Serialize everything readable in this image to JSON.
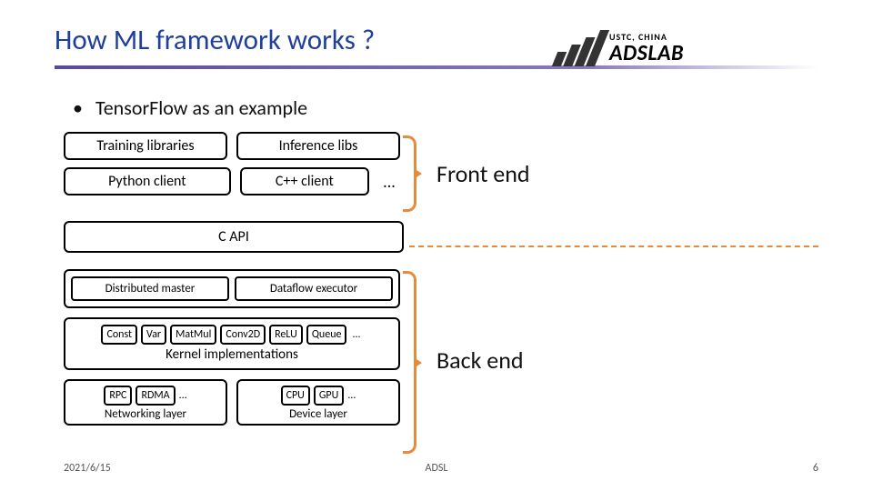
{
  "header": {
    "title": "How ML framework works ?",
    "logo_sub": "USTC, CHINA",
    "logo_main": "ADSLAB"
  },
  "bullet": "TensorFlow as an example",
  "diagram": {
    "front": {
      "row1": {
        "a": "Training libraries",
        "b": "Inference libs"
      },
      "row2": {
        "a": "Python client",
        "b": "C++ client",
        "ellipsis": "..."
      }
    },
    "capi": "C API",
    "back": {
      "topgroup": {
        "a": "Distributed master",
        "b": "Dataflow executor"
      },
      "kernel": {
        "chips": [
          "Const",
          "Var",
          "MatMul",
          "Conv2D",
          "ReLU",
          "Queue",
          "..."
        ],
        "title": "Kernel implementations"
      },
      "net": {
        "chips": [
          "RPC",
          "RDMA",
          "..."
        ],
        "title": "Networking layer"
      },
      "dev": {
        "chips": [
          "CPU",
          "GPU",
          "..."
        ],
        "title": "Device layer"
      }
    }
  },
  "labels": {
    "front": "Front end",
    "back": "Back end"
  },
  "footer": {
    "date": "2021/6/15",
    "center": "ADSL",
    "page": "6"
  }
}
